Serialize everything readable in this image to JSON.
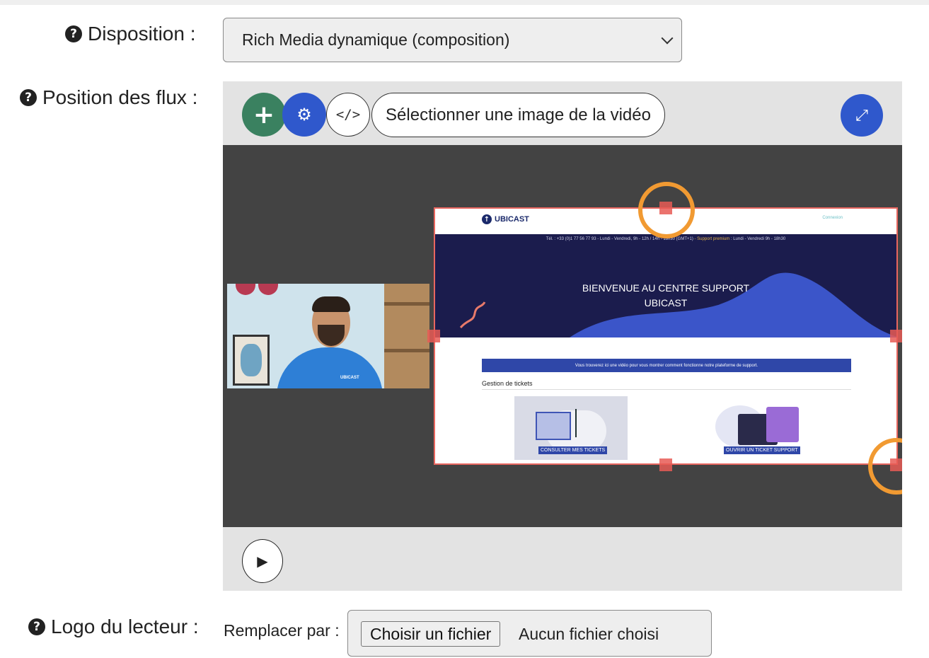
{
  "disposition": {
    "label": "Disposition :",
    "help_icon": "question-circle-icon",
    "selected_option": "Rich Media dynamique (composition)"
  },
  "position": {
    "label": "Position des flux :",
    "help_icon": "question-circle-icon",
    "toolbar": {
      "add_icon": "plus-icon",
      "settings_icon": "gear-icon",
      "code_icon": "code-icon",
      "select_frame_label": "Sélectionner une image de la vidéo",
      "fullscreen_icon": "expand-icon"
    },
    "preview": {
      "logo_text": "UBICAST",
      "connexion": "Connexion",
      "info_line_main": "Tél. : +33 (0)1 77 56 77 93 - Lundi - Vendredi, 9h - 12h / 14h - 18h30 (GMT+1)",
      "info_line_support": " - Support premium",
      "info_line_tail": " : Lundi - Vendredi 9h - 18h30",
      "hero_line1": "BIENVENUE AU CENTRE SUPPORT",
      "hero_line2": "UBICAST",
      "banner": "Vous trouverez ici une vidéo pour vous montrer comment fonctionne notre plateforme de support.",
      "section_title": "Gestion de tickets",
      "card1_label": "CONSULTER MES TICKETS",
      "card2_label": "OUVRIR UN TICKET SUPPORT",
      "tshirt_logo": "UBICAST"
    },
    "colors": {
      "accent_blue": "#2f58cc",
      "accent_green": "#3a8160",
      "handle_red": "#e85a55",
      "highlight_orange": "#f19a32"
    },
    "play_icon": "play-icon"
  },
  "logo": {
    "label": "Logo du lecteur :",
    "help_icon": "question-circle-icon",
    "replace_label": "Remplacer par :",
    "file_button": "Choisir un fichier",
    "file_status": "Aucun fichier choisi"
  }
}
